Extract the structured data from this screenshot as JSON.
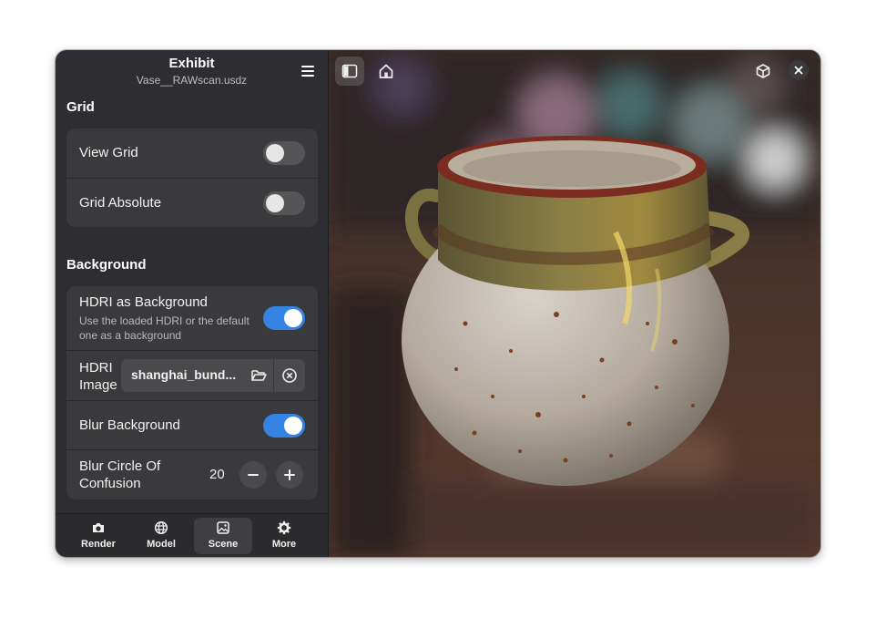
{
  "header": {
    "title": "Exhibit",
    "subtitle": "Vase__RAWscan.usdz",
    "menu_icon": "hamburger-menu-icon"
  },
  "sections": {
    "grid": {
      "title": "Grid",
      "rows": [
        {
          "label": "View Grid",
          "enabled": false
        },
        {
          "label": "Grid Absolute",
          "enabled": false
        }
      ]
    },
    "background": {
      "title": "Background",
      "hdri_bg": {
        "label": "HDRI as Background",
        "description": "Use the loaded HDRI or the default one as a background",
        "enabled": true
      },
      "hdri_image": {
        "label": "HDRI Image",
        "value": "shanghai_bund...",
        "open_icon": "folder-open-icon",
        "clear_icon": "clear-circle-icon"
      },
      "blur_bg": {
        "label": "Blur Background",
        "enabled": true
      },
      "blur_coc": {
        "label": "Blur Circle Of Confusion",
        "value": "20",
        "minus": "−",
        "plus": "+"
      }
    }
  },
  "tabs": [
    {
      "label": "Render",
      "icon": "camera-icon",
      "active": false
    },
    {
      "label": "Model",
      "icon": "globe-icon",
      "active": false
    },
    {
      "label": "Scene",
      "icon": "image-icon",
      "active": true
    },
    {
      "label": "More",
      "icon": "gear-icon",
      "active": false
    }
  ],
  "viewer": {
    "toolbar": [
      "sidebar-toggle-icon",
      "home-icon",
      "cube-icon",
      "close-icon"
    ]
  },
  "colors": {
    "accent": "#3584e4",
    "sidebar_bg": "#2e2e32",
    "card_bg": "#3a3a3d"
  }
}
